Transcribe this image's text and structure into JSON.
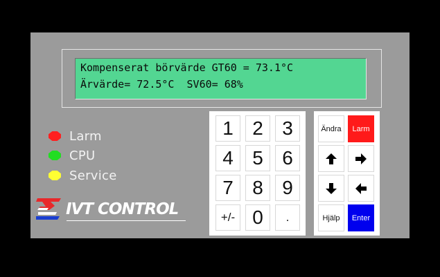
{
  "display": {
    "line1": "Kompenserat börvärde GT60 = 73.1°C",
    "line2": "Ärvärde= 72.5°C  SV60= 68%"
  },
  "indicators": [
    {
      "label": "Larm",
      "color": "#ff2020"
    },
    {
      "label": "CPU",
      "color": "#22dd22"
    },
    {
      "label": "Service",
      "color": "#ffff33"
    }
  ],
  "logo": {
    "text": "IVT CONTROL"
  },
  "keypad": {
    "keys": [
      "1",
      "2",
      "3",
      "4",
      "5",
      "6",
      "7",
      "8",
      "9",
      "+/-",
      "0",
      "."
    ]
  },
  "function_keys": {
    "andra": "Ändra",
    "larm": "Larm",
    "hjalp": "Hjälp",
    "enter": "Enter",
    "up_icon": "arrow-up",
    "right_icon": "arrow-right",
    "down_icon": "arrow-down",
    "left_icon": "arrow-left",
    "larm_color": "#ff1a1a",
    "enter_color": "#0000ee"
  }
}
